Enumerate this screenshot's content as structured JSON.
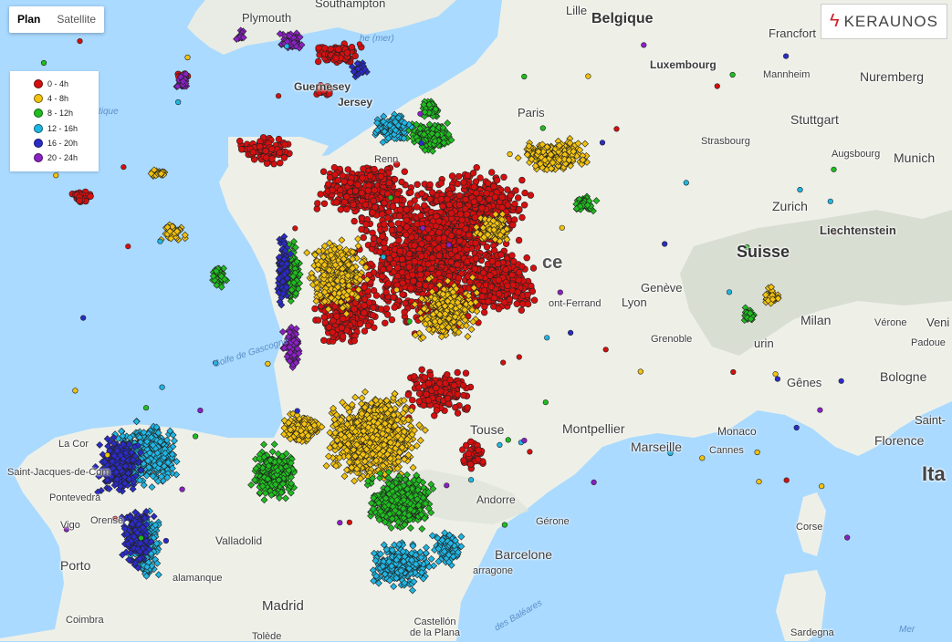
{
  "map_type": {
    "options": [
      "Plan",
      "Satellite"
    ],
    "selected": "Plan"
  },
  "brand": {
    "logo_text": "KERAUNOS",
    "accent": "#d0202a"
  },
  "legend": {
    "items": [
      {
        "label": "0 - 4h",
        "color": "#d40f0f"
      },
      {
        "label": "4 - 8h",
        "color": "#f2c20e"
      },
      {
        "label": "8 - 12h",
        "color": "#1fbd1f"
      },
      {
        "label": "12 - 16h",
        "color": "#1fb6e3"
      },
      {
        "label": "16 - 20h",
        "color": "#2b2bc8"
      },
      {
        "label": "20 - 24h",
        "color": "#8b20c4"
      }
    ]
  },
  "labels": {
    "southampton": "Southampton",
    "lille": "Lille",
    "belgique": "Belgique",
    "francfort": "Francfort",
    "plymouth": "Plymouth",
    "luxembourg": "Luxembourg",
    "mannheim": "Mannheim",
    "nuremberg": "Nuremberg",
    "guernesey": "Guernesey",
    "jersey": "Jersey",
    "paris": "Paris",
    "stuttgart": "Stuttgart",
    "strasbourg": "Strasbourg",
    "augsbourg": "Augsbourg",
    "munich": "Munich",
    "zurich": "Zurich",
    "liechtenstein": "Liechtenstein",
    "suisse": "Suisse",
    "rennes": "Renn",
    "france": "ce",
    "geneve": "Genève",
    "clermont": "ont-Ferrand",
    "lyon": "Lyon",
    "milan": "Milan",
    "verone": "Vérone",
    "padoue": "Padoue",
    "venise": "Veni",
    "grenoble": "Grenoble",
    "turin": "urin",
    "golfe": "Golfe de Gascogne",
    "genes": "Gênes",
    "bologne": "Bologne",
    "toulouse": "Touse",
    "montpellier": "Montpellier",
    "marseille": "Marseille",
    "monaco": "Monaco",
    "cannes": "Cannes",
    "saint": "Saint-",
    "florence": "Florence",
    "laCoruna": "La Cor",
    "saintJacques": "Saint-Jacques-de-Com",
    "pontevedra": "Pontevedra",
    "vigo": "Vigo",
    "orense": "Orense",
    "andorre": "Andorre",
    "ita": "Ita",
    "gerone": "Gérone",
    "corse": "Corse",
    "valladolid": "Valladolid",
    "porto": "Porto",
    "barcelone": "Barcelone",
    "salamanque": "alamanque",
    "tarragone": "arragone",
    "madrid": "Madrid",
    "coimbra": "Coimbra",
    "castellon": "Castellón\nde la Plana",
    "tolede": "Tolède",
    "sardegna": "Sardegna",
    "mer": "Mer",
    "baleares": "des Baléares",
    "atlantique": "tique",
    "manche": "he (mer)"
  }
}
